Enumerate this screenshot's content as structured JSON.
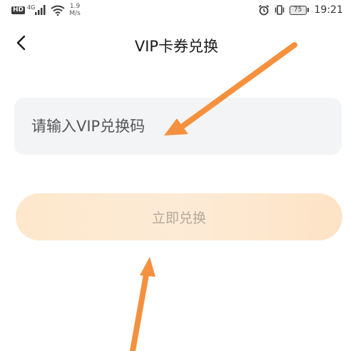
{
  "status_bar": {
    "network_badge": "HD",
    "network_type": "4G",
    "speed_value": "1.9",
    "speed_unit": "M/s",
    "battery_level": "75",
    "time": "19:21"
  },
  "header": {
    "title": "VIP卡券兑换"
  },
  "form": {
    "code_placeholder": "请输入VIP兑换码",
    "code_value": "",
    "redeem_label": "立即兑换"
  },
  "colors": {
    "accent_orange": "#f5913e",
    "button_gradient_start": "#fde8cc",
    "button_text": "#b3a79b",
    "input_bg": "#f3f4f6"
  },
  "icons": {
    "back": "chevron-left-icon",
    "signal": "signal-icon",
    "wifi": "wifi-icon",
    "alarm": "alarm-icon",
    "vibrate": "vibrate-icon",
    "battery": "battery-icon"
  }
}
